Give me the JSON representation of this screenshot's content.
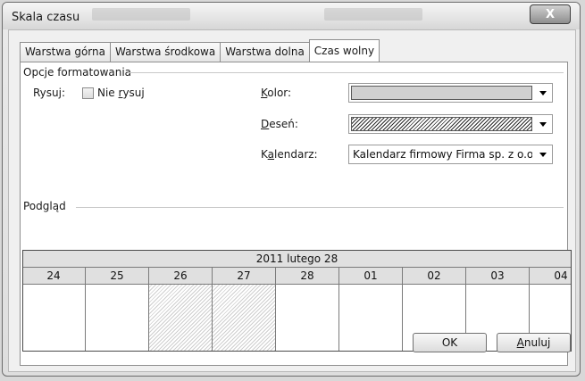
{
  "window": {
    "title": "Skala czasu"
  },
  "tabs": [
    {
      "label": "Warstwa górna",
      "active": false
    },
    {
      "label": "Warstwa środkowa",
      "active": false
    },
    {
      "label": "Warstwa dolna",
      "active": false
    },
    {
      "label": "Czas wolny",
      "active": true
    }
  ],
  "formatting": {
    "group_title": "Opcje formatowania",
    "draw_label": "Rysuj:",
    "dont_draw": {
      "label_pre": "Nie ",
      "label_u": "r",
      "label_post": "ysuj",
      "checked": false
    },
    "color": {
      "label_u": "K",
      "label_rest": "olor:",
      "value": "light-gray",
      "swatch": "#d0d0d0"
    },
    "pattern": {
      "label_u": "D",
      "label_rest": "eseń:",
      "value": "diagonal-hatch"
    },
    "calendar": {
      "label_pre": "K",
      "label_u": "a",
      "label_post": "lendarz:",
      "value": "Kalendarz firmowy Firma sp. z o.o. (t"
    }
  },
  "preview": {
    "group_title": "Podgląd",
    "date_header": "2011 lutego 28",
    "days": [
      "24",
      "25",
      "26",
      "27",
      "28",
      "01",
      "02",
      "03",
      "04"
    ],
    "nonworking_days": [
      "26",
      "27"
    ]
  },
  "buttons": {
    "ok": "OK",
    "cancel_u": "A",
    "cancel_rest": "nuluj"
  },
  "icons": {
    "close": "close-icon",
    "dropdown": "chevron-down-icon"
  }
}
